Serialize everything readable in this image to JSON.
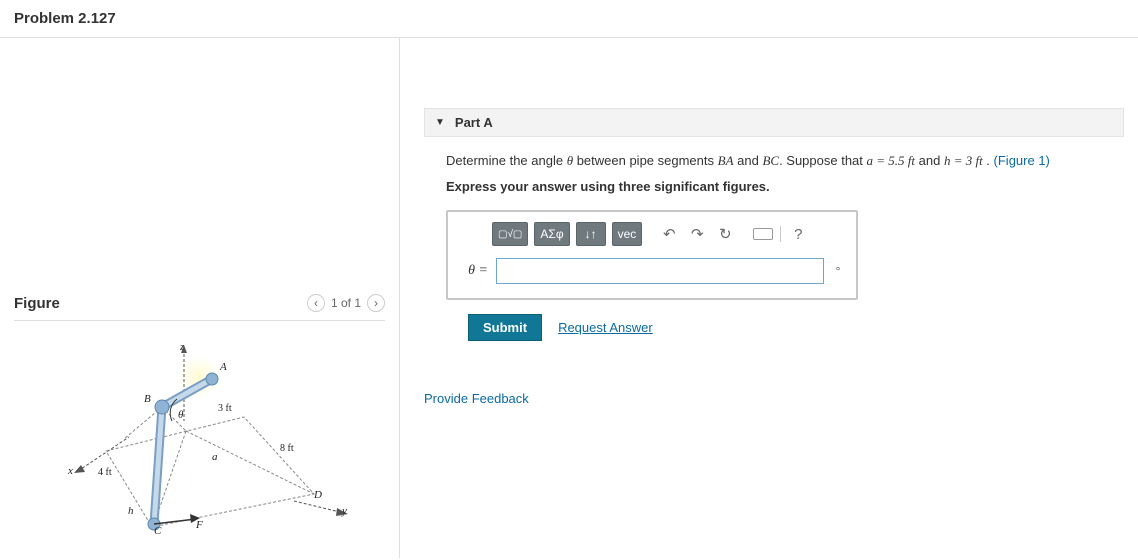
{
  "problem": {
    "title": "Problem 2.127"
  },
  "figure": {
    "heading": "Figure",
    "pager": {
      "label": "1 of 1"
    },
    "labels": {
      "z": "z",
      "A": "A",
      "B": "B",
      "theta": "θ",
      "x": "x",
      "C": "C",
      "F": "F",
      "D": "D",
      "y": "y",
      "h": "h",
      "a": "a",
      "d3ft": "3 ft",
      "d8ft": "8 ft",
      "d4ft": "4 ft"
    }
  },
  "part": {
    "collapse": "▼",
    "title": "Part A",
    "question_pre": "Determine the angle ",
    "theta": "θ",
    "question_mid": " between pipe segments ",
    "seg1": "BA",
    "and": " and ",
    "seg2": "BC",
    "suppose": ". Suppose that ",
    "a_eq": "a = 5.5  ft",
    "h_and": " and ",
    "h_eq": "h = 3  ft",
    "period": " . ",
    "figlink": "(Figure 1)",
    "instruction": "Express your answer using three significant figures.",
    "toolbar": {
      "template": "▢√▢",
      "greek": "ΑΣφ",
      "subsup": "↓↑",
      "vec": "vec",
      "undo": "↶",
      "redo": "↷",
      "reset": "↻",
      "help": "?"
    },
    "var": "θ =",
    "unit": "°",
    "submit": "Submit",
    "request": "Request Answer"
  },
  "feedback": "Provide Feedback"
}
